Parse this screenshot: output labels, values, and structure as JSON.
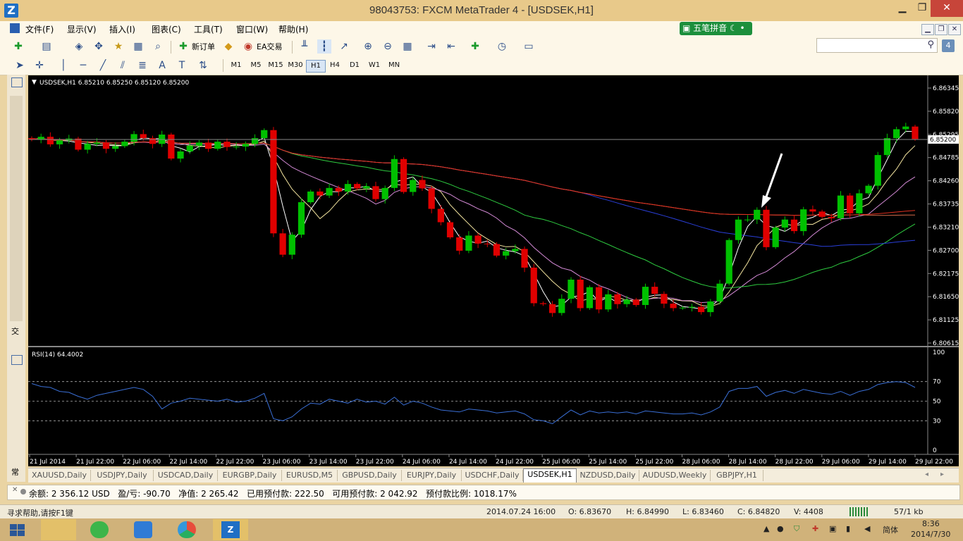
{
  "window": {
    "title": "98043753: FXCM MetaTrader 4 - [USDSEK,H1]",
    "app_icon": "Z"
  },
  "menu": [
    "文件(F)",
    "显示(V)",
    "插入(I)",
    "图表(C)",
    "工具(T)",
    "窗口(W)",
    "帮助(H)"
  ],
  "ime_indicator": "五笔拼音",
  "toolbar": {
    "new_order": "新订单",
    "ea_trading": "EA交易"
  },
  "timeframes": [
    "M1",
    "M5",
    "M15",
    "M30",
    "H1",
    "H4",
    "D1",
    "W1",
    "MN"
  ],
  "active_timeframe": "H1",
  "left_strip_glyphs": {
    "top": "交",
    "bottom": "常"
  },
  "chart": {
    "header": "USDSEK,H1  6.85210 6.85250 6.85120 6.85200",
    "current_price_label": "6.85200",
    "price_ticks": [
      "6.86345",
      "6.85820",
      "6.85295",
      "6.84785",
      "6.84260",
      "6.83735",
      "6.83210",
      "6.82700",
      "6.82175",
      "6.81650",
      "6.81125",
      "6.80615"
    ],
    "time_labels": [
      "21 Jul 2014",
      "21 Jul 22:00",
      "22 Jul 06:00",
      "22 Jul 14:00",
      "22 Jul 22:00",
      "23 Jul 06:00",
      "23 Jul 14:00",
      "23 Jul 22:00",
      "24 Jul 06:00",
      "24 Jul 14:00",
      "24 Jul 22:00",
      "25 Jul 06:00",
      "25 Jul 14:00",
      "25 Jul 22:00",
      "28 Jul 06:00",
      "28 Jul 14:00",
      "28 Jul 22:00",
      "29 Jul 06:00",
      "29 Jul 14:00",
      "29 Jul 22:00"
    ],
    "colors": {
      "bull": "#00c000",
      "bear": "#e00000",
      "rsi": "#3a6fd6",
      "ma_white": "#ffffff",
      "ma_yellow": "#f5e6a0",
      "ma_violet": "#d48ad6",
      "ma_green": "#2ecc40",
      "ma_blue": "#2a3fd9",
      "ma_salmon": "#d46a4a",
      "ma_red": "#e03020"
    }
  },
  "rsi": {
    "header": "RSI(14) 64.4002",
    "ticks": [
      "100",
      "70",
      "50",
      "30",
      "0"
    ]
  },
  "chart_data": {
    "type": "candlestick",
    "title": "USDSEK,H1",
    "ylim": [
      6.80615,
      6.86345
    ],
    "close_series": [
      6.8519,
      6.8525,
      6.8508,
      6.8517,
      6.8521,
      6.8496,
      6.8509,
      6.8512,
      6.8498,
      6.8504,
      6.8514,
      6.8531,
      6.8522,
      6.8509,
      6.853,
      6.8476,
      6.8492,
      6.8505,
      6.8512,
      6.8498,
      6.8514,
      6.8502,
      6.8503,
      6.8509,
      6.8522,
      6.854,
      6.8308,
      6.826,
      6.8305,
      6.8378,
      6.8402,
      6.8393,
      6.841,
      6.8402,
      6.8419,
      6.8409,
      6.8414,
      6.8385,
      6.841,
      6.8475,
      6.8401,
      6.8428,
      6.8409,
      6.8363,
      6.8333,
      6.8299,
      6.8269,
      6.8303,
      6.8285,
      6.8284,
      6.8258,
      6.8268,
      6.8273,
      6.8231,
      6.8151,
      6.8149,
      6.8129,
      6.8161,
      6.8204,
      6.814,
      6.8187,
      6.8137,
      6.8171,
      6.8149,
      6.8159,
      6.8147,
      6.8188,
      6.8172,
      6.815,
      6.814,
      6.8141,
      6.8143,
      6.8131,
      6.8155,
      6.8195,
      6.8293,
      6.8339,
      6.8339,
      6.8361,
      6.8277,
      6.8321,
      6.8339,
      6.8313,
      6.8362,
      6.8357,
      6.8345,
      6.8342,
      6.8393,
      6.8353,
      6.8398,
      6.8415,
      6.8484,
      6.8522,
      6.8542,
      6.8548,
      6.852
    ],
    "rsi_series": [
      68,
      65,
      64,
      60,
      59,
      55,
      52,
      56,
      58,
      60,
      62,
      64,
      62,
      55,
      42,
      48,
      50,
      53,
      52,
      51,
      50,
      52,
      49,
      50,
      53,
      58,
      32,
      30,
      34,
      42,
      48,
      47,
      52,
      50,
      48,
      52,
      49,
      50,
      47,
      54,
      46,
      50,
      48,
      44,
      41,
      40,
      39,
      42,
      41,
      40,
      38,
      39,
      40,
      37,
      31,
      30,
      27,
      34,
      41,
      36,
      40,
      38,
      39,
      38,
      39,
      37,
      40,
      39,
      38,
      37,
      37,
      38,
      36,
      39,
      44,
      60,
      63,
      63,
      65,
      55,
      59,
      61,
      58,
      62,
      60,
      58,
      57,
      60,
      56,
      60,
      62,
      67,
      69,
      70,
      69,
      64
    ],
    "ma_overlays_count": 7
  },
  "tabs": [
    "XAUUSD,Daily",
    "USDJPY,Daily",
    "USDCAD,Daily",
    "EURGBP,Daily",
    "EURUSD,M5",
    "GBPUSD,Daily",
    "EURJPY,Daily",
    "USDCHF,Daily",
    "USDSEK,H1",
    "NZDUSD,Daily",
    "AUDUSD,Weekly",
    "GBPJPY,H1"
  ],
  "active_tab": "USDSEK,H1",
  "account": {
    "line": "余额: 2 356.12 USD   盈/亏: -90.70   净值: 2 265.42   已用预付款: 222.50   可用预付款: 2 042.92   预付款比例: 1018.17%"
  },
  "status": {
    "help": "寻求帮助,请按F1键",
    "datetime": "2014.07.24 16:00",
    "open": "O: 6.83670",
    "high": "H: 6.84990",
    "low": "L: 6.83460",
    "close": "C: 6.84820",
    "volume": "V: 4408",
    "traffic": "57/1 kb"
  },
  "taskbar": {
    "time": "8:36",
    "date": "2014/7/30",
    "ime": "简体"
  }
}
